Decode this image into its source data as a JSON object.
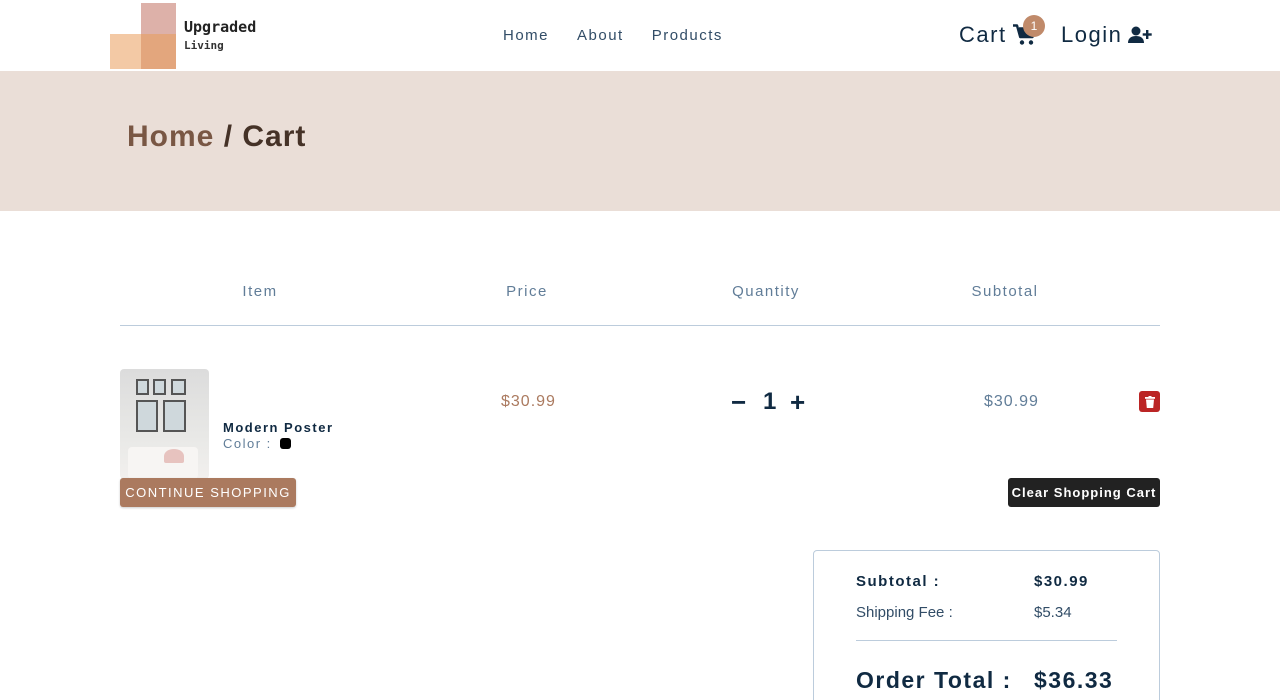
{
  "header": {
    "logo": {
      "line1": "Upgraded",
      "line2": "Living"
    },
    "nav": [
      "Home",
      "About",
      "Products"
    ],
    "cart_label": "Cart",
    "cart_count": "1",
    "login_label": "Login",
    "icons": {
      "cart": "shopping-cart-icon",
      "login": "user-plus-icon"
    }
  },
  "hero": {
    "crumb_home": "Home",
    "crumb_sep": " / ",
    "crumb_current": "Cart"
  },
  "table": {
    "columns": [
      "Item",
      "Price",
      "Quantity",
      "Subtotal"
    ],
    "items": [
      {
        "name": "Modern Poster",
        "color_label": "Color :",
        "color": "#000000",
        "price": "$30.99",
        "quantity": "1",
        "subtotal": "$30.99"
      }
    ]
  },
  "actions": {
    "continue": "CONTINUE SHOPPING",
    "clear": "Clear Shopping Cart"
  },
  "totals": {
    "subtotal_label": "Subtotal :",
    "subtotal": "$30.99",
    "shipping_label": "Shipping Fee :",
    "shipping": "$5.34",
    "order_total_label": "Order Total :",
    "order_total": "$36.33"
  },
  "colors": {
    "accent": "#ab7a5f",
    "hero_bg": "#eaded7",
    "danger": "#bb2525"
  }
}
